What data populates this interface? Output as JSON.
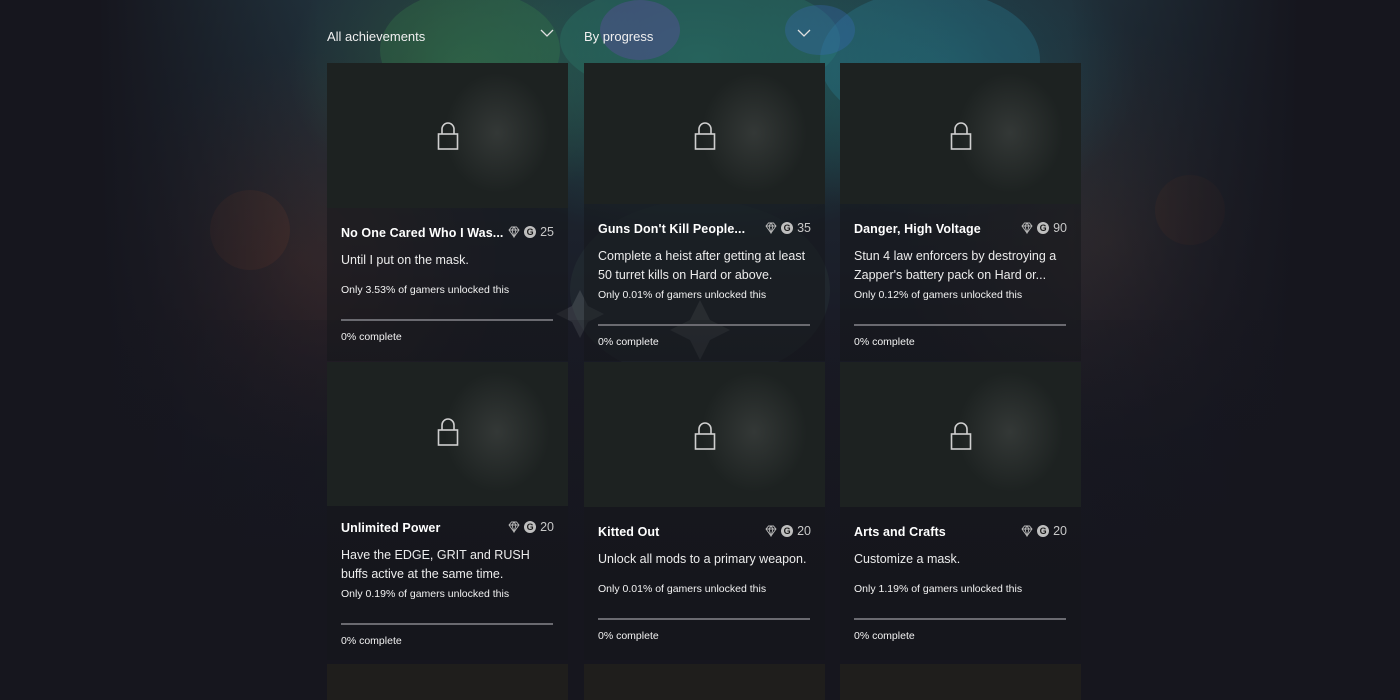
{
  "filters": {
    "category": {
      "selected": "All achievements"
    },
    "sort": {
      "selected": "By progress"
    }
  },
  "colors": {
    "background": "#16161e",
    "card": "#1d2221",
    "progress_track": "#6a6a70",
    "text_primary": "#ffffff",
    "text_secondary": "#c8c8c8"
  },
  "achievements": [
    {
      "title": "No One Cared Who I Was...",
      "gamerscore": "25",
      "description": "Until I put on the mask.",
      "rarity": "Only 3.53% of gamers unlocked this",
      "progress": 0,
      "progress_label": "0% complete",
      "icon": "lock-icon"
    },
    {
      "title": "Guns Don't Kill People...",
      "gamerscore": "35",
      "description": "Complete a heist after getting at least 50 turret kills on Hard or above.",
      "rarity": "Only 0.01% of gamers unlocked this",
      "progress": 0,
      "progress_label": "0% complete",
      "icon": "lock-icon"
    },
    {
      "title": "Danger, High Voltage",
      "gamerscore": "90",
      "description": "Stun 4 law enforcers by destroying a Zapper's battery pack on Hard or...",
      "rarity": "Only 0.12% of gamers unlocked this",
      "progress": 0,
      "progress_label": "0% complete",
      "icon": "lock-icon"
    },
    {
      "title": "Unlimited Power",
      "gamerscore": "20",
      "description": "Have the EDGE, GRIT and RUSH buffs active at the same time.",
      "rarity": "Only 0.19% of gamers unlocked this",
      "progress": 0,
      "progress_label": "0% complete",
      "icon": "lock-icon"
    },
    {
      "title": "Kitted Out",
      "gamerscore": "20",
      "description": "Unlock all mods to a primary weapon.",
      "rarity": "Only 0.01% of gamers unlocked this",
      "progress": 0,
      "progress_label": "0% complete",
      "icon": "lock-icon"
    },
    {
      "title": "Arts and Crafts",
      "gamerscore": "20",
      "description": "Customize a mask.",
      "rarity": "Only 1.19% of gamers unlocked this",
      "progress": 0,
      "progress_label": "0% complete",
      "icon": "lock-icon"
    }
  ],
  "gamerscore_badge": "G"
}
